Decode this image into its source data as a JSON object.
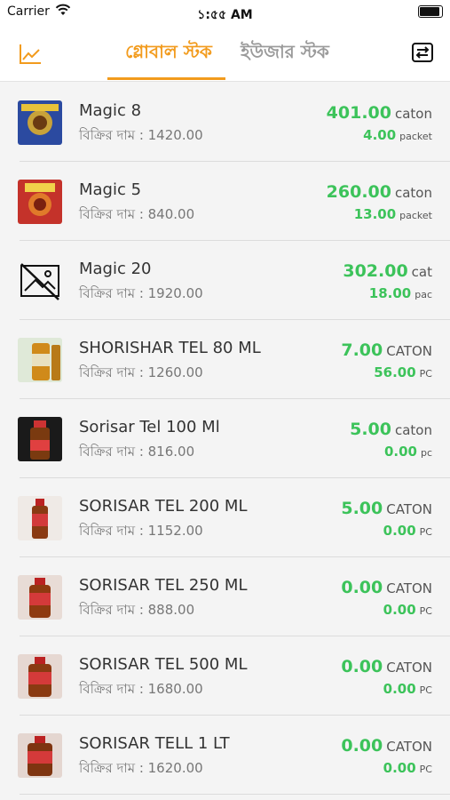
{
  "status": {
    "carrier": "Carrier",
    "time": "১:৫৫ AM"
  },
  "header": {
    "tabs": [
      {
        "label": "গ্লোবাল স্টক",
        "active": true
      },
      {
        "label": "ইউজার স্টক",
        "active": false
      }
    ],
    "left_icon": "chart-icon",
    "right_icon": "swap-icon",
    "accent": "#f29b1d"
  },
  "items": [
    {
      "name": "Magic 8",
      "price": "বিক্রির দাম : 1420.00",
      "q1": "401.00",
      "u1": "caton",
      "q2": "4.00",
      "u2": "packet",
      "thumb": "box-blue"
    },
    {
      "name": "Magic 5",
      "price": "বিক্রির দাম : 840.00",
      "q1": "260.00",
      "u1": "caton",
      "q2": "13.00",
      "u2": "packet",
      "thumb": "box-red"
    },
    {
      "name": "Magic 20",
      "price": "বিক্রির দাম : 1920.00",
      "q1": "302.00",
      "u1": "cat",
      "q2": "18.00",
      "u2": "pac",
      "thumb": "no-image"
    },
    {
      "name": "SHORISHAR TEL 80 ML",
      "price": "বিক্রির দাম : 1260.00",
      "q1": "7.00",
      "u1": "CATON",
      "q2": "56.00",
      "u2": "PC",
      "thumb": "bottle"
    },
    {
      "name": "Sorisar Tel 100 Ml",
      "price": "বিক্রির দাম : 816.00",
      "q1": "5.00",
      "u1": "caton",
      "q2": "0.00",
      "u2": "pc",
      "thumb": "bottle-dark"
    },
    {
      "name": "SORISAR TEL 200 ML",
      "price": "বিক্রির দাম : 1152.00",
      "q1": "5.00",
      "u1": "CATON",
      "q2": "0.00",
      "u2": "PC",
      "thumb": "bottle"
    },
    {
      "name": "SORISAR TEL 250 ML",
      "price": "বিক্রির দাম : 888.00",
      "q1": "0.00",
      "u1": "CATON",
      "q2": "0.00",
      "u2": "PC",
      "thumb": "bottle"
    },
    {
      "name": "SORISAR TEL 500 ML",
      "price": "বিক্রির দাম : 1680.00",
      "q1": "0.00",
      "u1": "CATON",
      "q2": "0.00",
      "u2": "PC",
      "thumb": "bottle"
    },
    {
      "name": "SORISAR TELL 1 LT",
      "price": "বিক্রির দাম : 1620.00",
      "q1": "0.00",
      "u1": "CATON",
      "q2": "0.00",
      "u2": "PC",
      "thumb": "bottle"
    }
  ],
  "colors": {
    "quantity": "#3cc35a",
    "background": "#f4f4f4"
  }
}
